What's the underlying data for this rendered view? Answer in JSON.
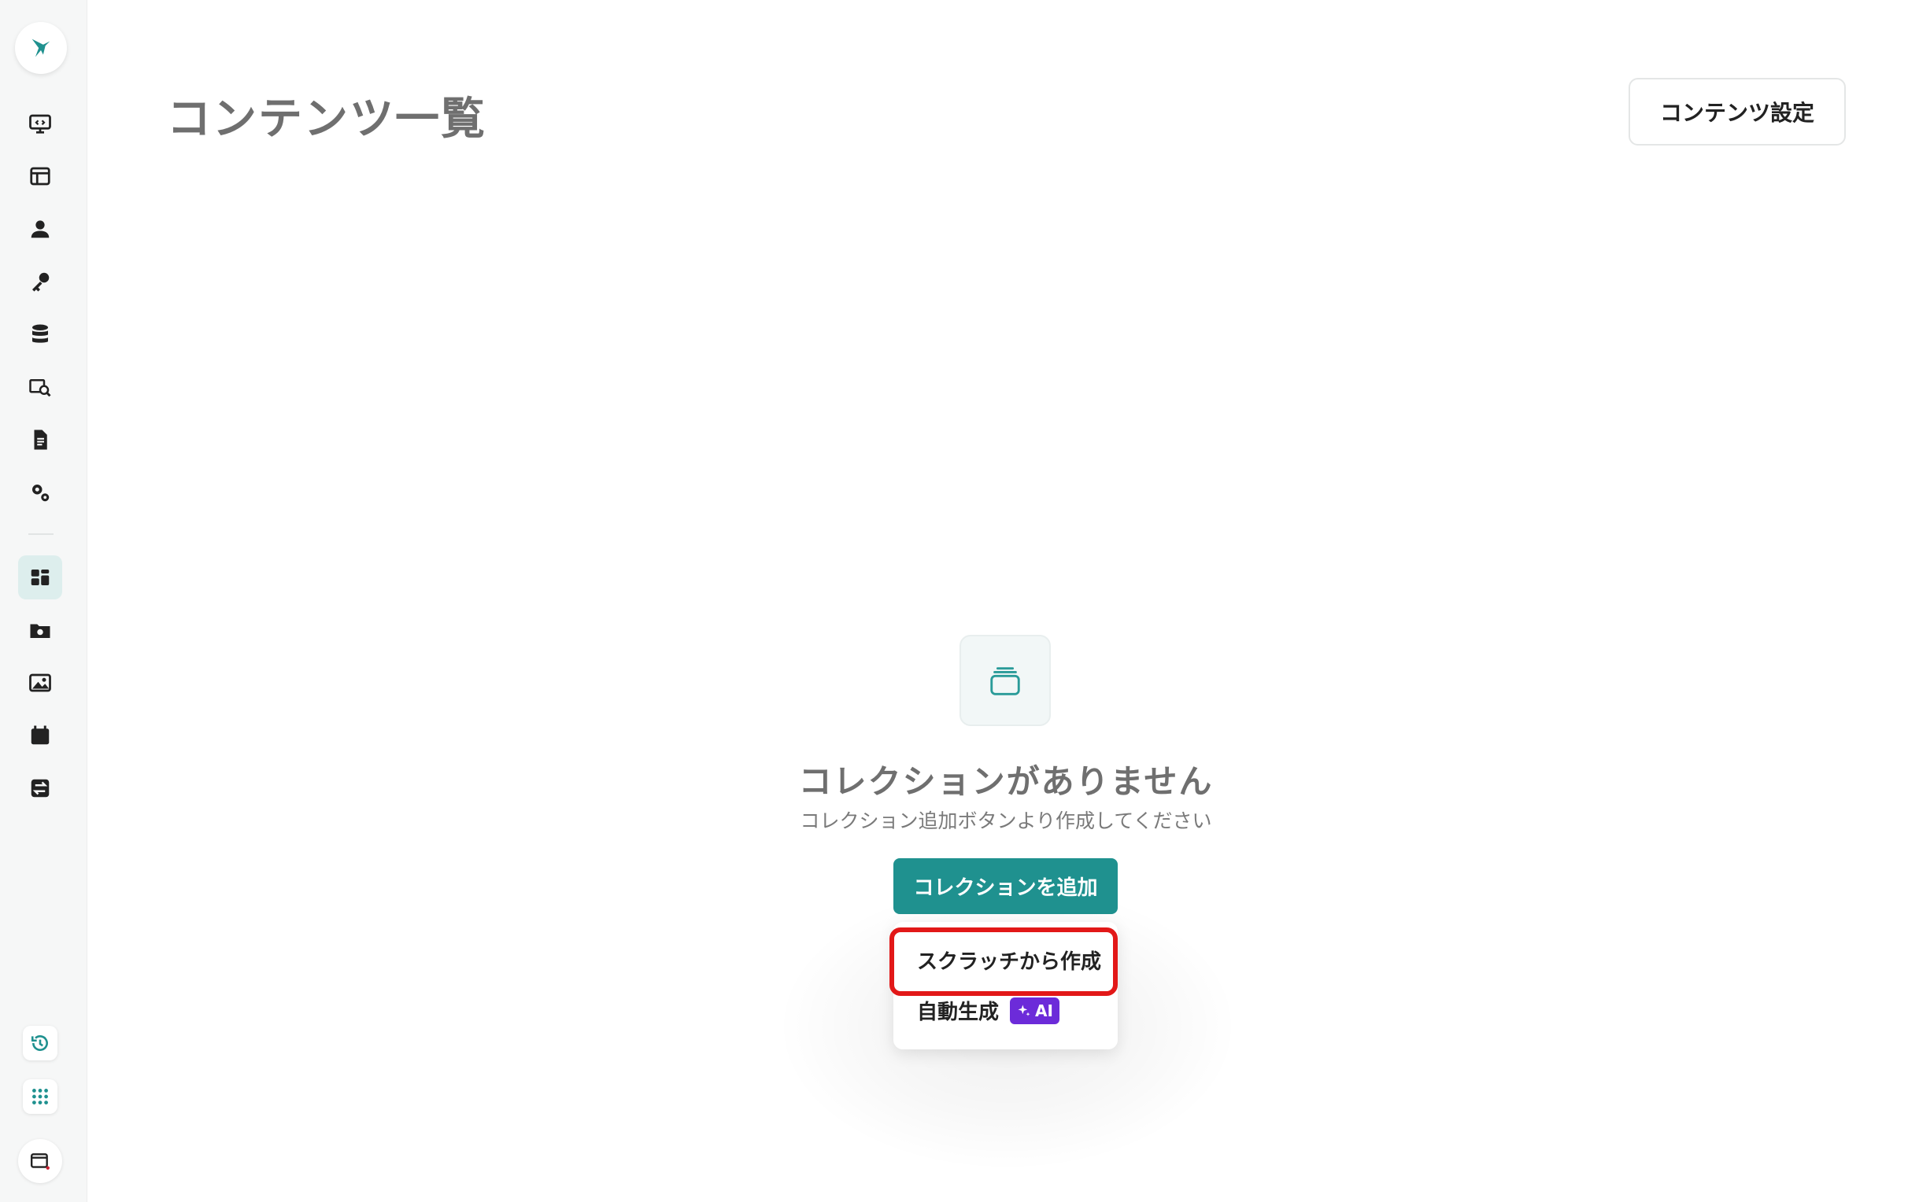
{
  "header": {
    "title": "コンテンツ一覧",
    "settings_label": "コンテンツ設定"
  },
  "sidebar": {
    "items": [
      {
        "icon": "monitor-icon"
      },
      {
        "icon": "layout-icon"
      },
      {
        "icon": "user-icon"
      },
      {
        "icon": "key-icon"
      },
      {
        "icon": "database-icon"
      },
      {
        "icon": "inspect-icon"
      },
      {
        "icon": "file-icon"
      },
      {
        "icon": "gears-icon"
      },
      {
        "icon": "dashboard-icon",
        "active": true
      },
      {
        "icon": "folder-settings-icon"
      },
      {
        "icon": "image-icon"
      },
      {
        "icon": "calendar-icon"
      },
      {
        "icon": "transfer-icon"
      }
    ],
    "bottom": [
      {
        "icon": "history-icon"
      },
      {
        "icon": "apps-grid-icon"
      },
      {
        "icon": "window-icon"
      }
    ]
  },
  "empty_state": {
    "title": "コレクションがありません",
    "subtitle": "コレクション追加ボタンより作成してください",
    "add_button_label": "コレクションを追加"
  },
  "dropdown": {
    "scratch_label": "スクラッチから作成",
    "auto_label": "自動生成",
    "ai_badge": "AI"
  },
  "colors": {
    "accent": "#1f918f",
    "highlight": "#e21818",
    "ai_badge": "#6c2bd9"
  }
}
